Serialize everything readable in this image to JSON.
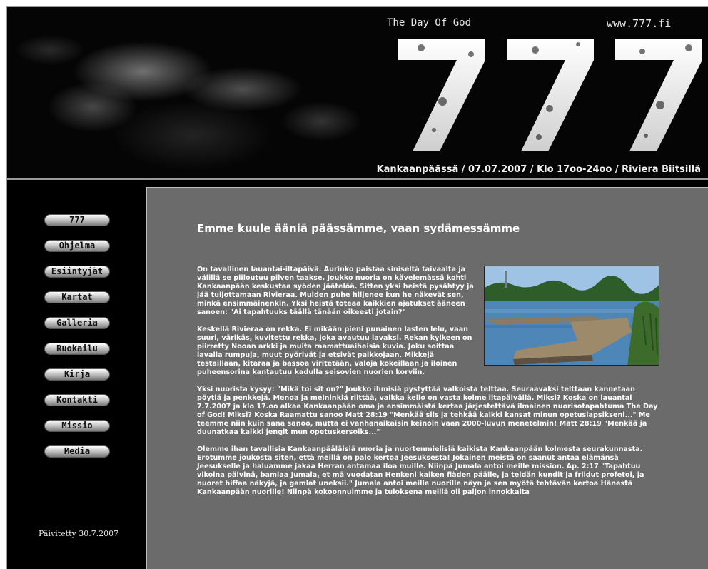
{
  "header": {
    "tagline": "The Day Of God",
    "site_url": "www.777.fi",
    "logo_digits": "777",
    "event_line": "Kankaanpäässä / 07.07.2007 / Klo 17oo-24oo / Riviera Biitsillä"
  },
  "nav": {
    "items": [
      {
        "label": "777"
      },
      {
        "label": "Ohjelma"
      },
      {
        "label": "Esiintyjät"
      },
      {
        "label": "Kartat"
      },
      {
        "label": "Galleria"
      },
      {
        "label": "Ruokailu"
      },
      {
        "label": "Kirja"
      },
      {
        "label": "Kontakti"
      },
      {
        "label": "Missio"
      },
      {
        "label": "Media"
      }
    ]
  },
  "sidebar": {
    "updated": "Päivitetty 30.7.2007"
  },
  "content": {
    "title": "Emme kuule ääniä päässämme, vaan sydämessämme",
    "paragraphs": [
      "On tavallinen lauantai-iltapäivä. Aurinko paistaa siniseltä taivaalta ja välillä se piiloutuu pilven taakse. Joukko nuoria on kävelemässä kohti Kankaanpään keskustaa syöden jäätelöä. Sitten yksi heistä pysähtyy ja jää tuijottamaan Rivieraa. Muiden puhe hiljenee kun he näkevät sen, minkä ensimmäinenkin. Yksi heistä toteaa kaikkien ajatukset ääneen sanoen: \"Ai tapahtuuks täällä tänään oikeesti jotain?\"",
      "Keskellä Rivieraa on rekka. Ei mikään pieni punainen lasten lelu, vaan suuri, värikäs, kuvitettu rekka, joka avautuu lavaksi. Rekan kylkeen on piirretty Nooan arkki ja muita raamattuaiheisia kuvia. Joku soittaa lavalla rumpuja, muut pyörivät ja etsivät paikkojaan. Mikkejä testaillaan, kitaraa ja bassoa viritetään, valoja kokeillaan ja iloinen puheensorina kantautuu kadulla seisovien nuorien korviin.",
      "Yksi nuorista kysyy: \"Mikä toi sit on?\" Joukko ihmisiä pystyttää valkoista telttaa. Seuraavaksi telttaan kannetaan pöytiä ja penkkejä. Menoa ja meininkiä riittää, vaikka kello on vasta kolme iltapäivällä. Miksi? Koska on lauantai 7.7.2007 ja klo 17.oo alkaa Kankaanpään oma ja ensimmäistä kertaa järjestettävä ilmainen nuorisotapahtuma The Day of God! Miksi? Koska Raamattu sanoo Matt 28:19 \"Menkää siis ja tehkää kaikki kansat minun opetuslapsikseni...\" Me teemme niin kuin sana sanoo, mutta ei vanhanaikaisin keinoin vaan 2000-luvun menetelmin! Matt 28:19 \"Menkää ja duunatkaa kaikki jengit mun opetuskersoiks...\"",
      "Olemme ihan tavallisia Kankaanpääläisiä nuoria ja nuortenmielisiä kaikista Kankaanpään kolmesta seurakunnasta. Erotumme joukosta siten, että meillä on palo kertoa Jeesuksesta! Jokainen meistä on saanut antaa elämänsä Jeesukselle ja haluamme jakaa Herran antamaa iloa muille. Niinpä Jumala antoi meille mission. Ap. 2:17 \"Tapahtuu vikoina päivinä, bamlaa Jumala, et mä vuodatan Henkeni kaiken fläden päälle, ja teidän kundit ja friidut profetoi, ja nuoret hiffaa näkyjä, ja gamlat uneksii.\" Jumala antoi meille nuorille näyn ja sen myötä tehtävän kertoa Hänestä Kankaanpään nuorille! Niinpä kokoonnuimme ja tuloksena meillä oli paljon innokkaita"
    ]
  },
  "colors": {
    "page_bg": "#ffffff",
    "frame_bg": "#000000",
    "content_bg": "#6b6b6b",
    "text": "#ffffff"
  }
}
